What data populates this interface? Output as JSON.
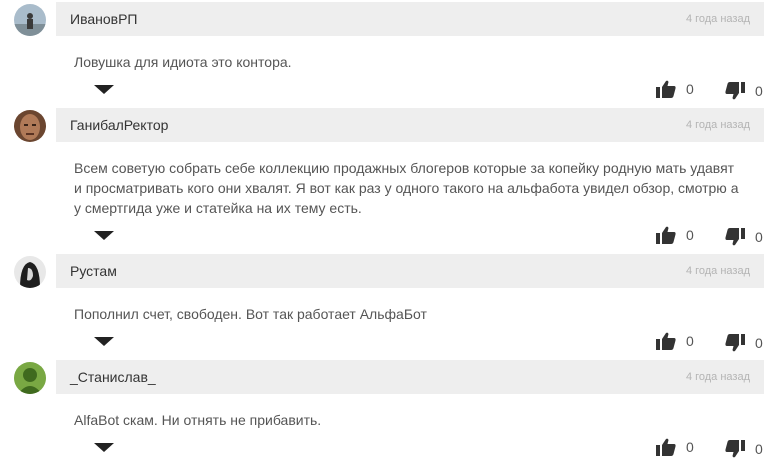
{
  "comments": [
    {
      "author": "ИвановРП",
      "time": "4 года назад",
      "text": "Ловушка для идиота это контора.",
      "likes": "0",
      "dislikes": "0",
      "avatar_color": "#8fa6b8"
    },
    {
      "author": "ГанибалРектор",
      "time": "4 года назад",
      "text": "Всем советую собрать себе коллекцию продажных блогеров которые за копейку родную мать удавят и просматривать кого они хвалят. Я вот как раз у одного такого на альфабота увидел обзор, смотрю а у смертгида уже и статейка на их тему есть.",
      "likes": "0",
      "dislikes": "0",
      "avatar_color": "#8a5a3c"
    },
    {
      "author": "Рустам",
      "time": "4 года назад",
      "text": "Пополнил счет, свободен. Вот так работает АльфаБот",
      "likes": "0",
      "dislikes": "0",
      "avatar_color": "#2a2a2a"
    },
    {
      "author": "_Станислав_",
      "time": "4 года назад",
      "text": "AlfaBot скам. Ни отнять не прибавить.",
      "likes": "0",
      "dislikes": "0",
      "avatar_color": "#5f8f2e"
    }
  ],
  "icons": {
    "like": "thumbs-up-icon",
    "dislike": "thumbs-down-icon",
    "reply_toggle": "triangle-down-icon"
  }
}
